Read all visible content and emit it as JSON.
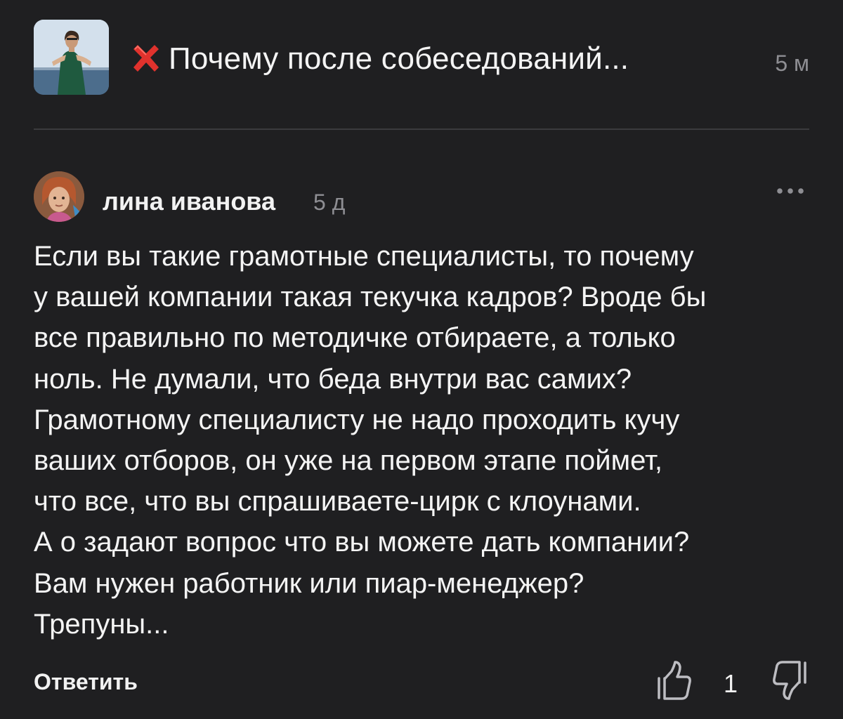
{
  "post": {
    "title": "Почему после собеседований...",
    "time": "5 м",
    "thumbnail_icon": "post-thumbnail-photo",
    "status_icon": "red-cross-icon"
  },
  "comment": {
    "author": "лина иванова",
    "time": "5 д",
    "avatar_icon": "user-avatar-photo",
    "more_icon": "ellipsis-icon",
    "text_lines": [
      "Если вы такие грамотные специалисты, то почему",
      "у вашей компании такая текучка кадров? Вроде бы",
      "все правильно по методичке отбираете, а только",
      "ноль. Не думали, что беда внутри вас самих?",
      "Грамотному специалисту не надо проходить кучу",
      "ваших отборов, он уже на первом этапе поймет,",
      "что все, что вы спрашиваете-цирк с клоунами.",
      "А о задают вопрос что вы можете дать компании?",
      "Вам нужен работник или пиар-менеджер?",
      "Трепуны..."
    ]
  },
  "actions": {
    "reply_label": "Ответить",
    "like_icon": "thumbs-up-icon",
    "like_count": "1",
    "dislike_icon": "thumbs-down-icon"
  },
  "colors": {
    "background": "#1f1f21",
    "text": "#f4f4f4",
    "muted": "#8e8e93",
    "accent_cross": "#e0322d"
  }
}
